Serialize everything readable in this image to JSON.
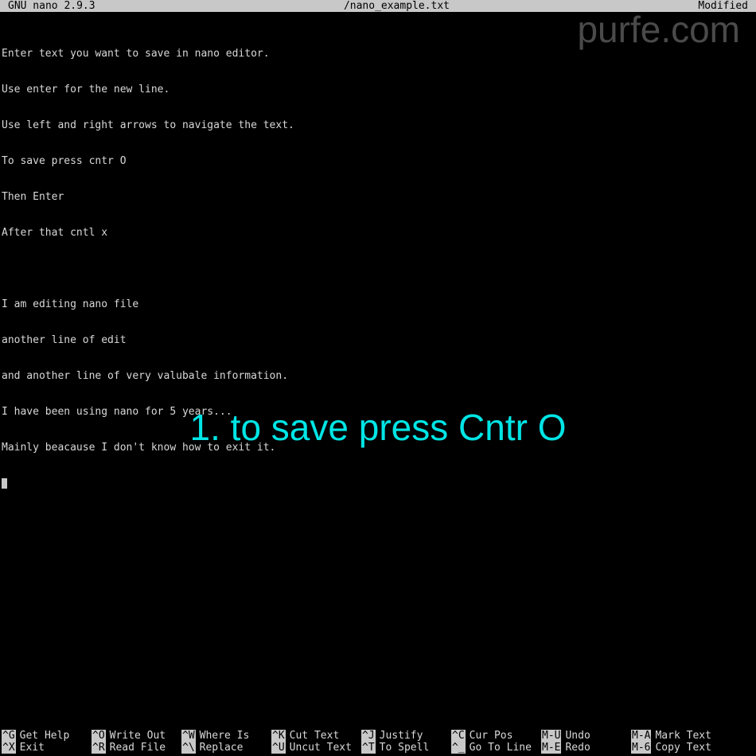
{
  "titlebar": {
    "app": "GNU nano 2.9.3",
    "file": "/nano_example.txt",
    "status": "Modified"
  },
  "editor_lines": [
    "Enter text you want to save in nano editor.",
    "Use enter for the new line.",
    "Use left and right arrows to navigate the text.",
    "To save press cntr O",
    "Then Enter",
    "After that cntl x",
    "",
    "I am editing nano file",
    "another line of edit",
    "and another line of very valubale information.",
    "I have been using nano for 5 years...",
    "Mainly beacause I don't know how to exit it."
  ],
  "watermark": "purfe.com",
  "overlay": "1. to save press Cntr O",
  "shortcuts_row1": [
    {
      "key": "^G",
      "label": "Get Help"
    },
    {
      "key": "^O",
      "label": "Write Out"
    },
    {
      "key": "^W",
      "label": "Where Is"
    },
    {
      "key": "^K",
      "label": "Cut Text"
    },
    {
      "key": "^J",
      "label": "Justify"
    },
    {
      "key": "^C",
      "label": "Cur Pos"
    },
    {
      "key": "M-U",
      "label": "Undo"
    },
    {
      "key": "M-A",
      "label": "Mark Text"
    }
  ],
  "shortcuts_row2": [
    {
      "key": "^X",
      "label": "Exit"
    },
    {
      "key": "^R",
      "label": "Read File"
    },
    {
      "key": "^\\",
      "label": "Replace"
    },
    {
      "key": "^U",
      "label": "Uncut Text"
    },
    {
      "key": "^T",
      "label": "To Spell"
    },
    {
      "key": "^_",
      "label": "Go To Line"
    },
    {
      "key": "M-E",
      "label": "Redo"
    },
    {
      "key": "M-6",
      "label": "Copy Text"
    }
  ]
}
